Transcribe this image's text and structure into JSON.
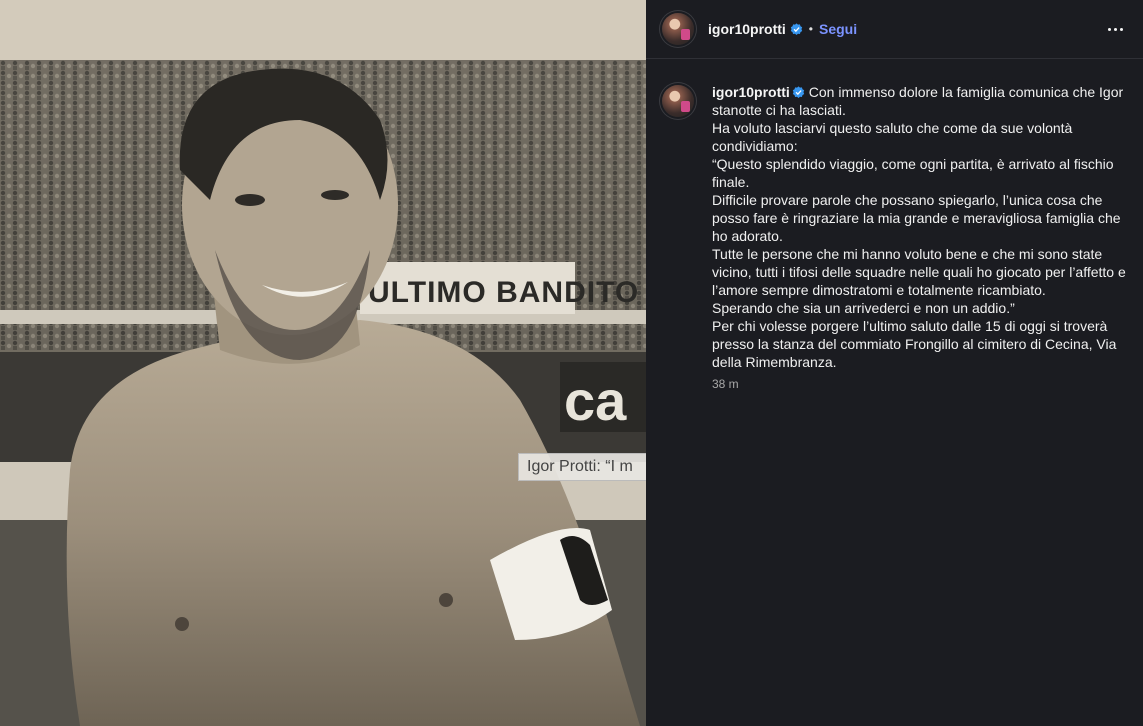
{
  "media": {
    "overlay_label": "Igor Protti: “I m",
    "banner_text": "ULTIMO BANDITO",
    "sponsor_text": "ca"
  },
  "header": {
    "username": "igor10protti",
    "separator": "•",
    "follow_label": "Segui",
    "more_icon": "more-horizontal-icon"
  },
  "caption": {
    "username": "igor10protti",
    "text": "Con immenso dolore la famiglia comunica che Igor stanotte ci ha lasciati.\nHa voluto lasciarvi questo saluto che come da sue volontà condividiamo:\n“Questo splendido viaggio, come ogni partita, è arrivato al fischio finale.\nDifficile provare parole che possano spiegarlo, l’unica cosa che posso fare è ringraziare la mia grande e meravigliosa famiglia che ho adorato.\nTutte le persone che mi hanno voluto bene e che mi sono state vicino, tutti i tifosi delle squadre nelle quali ho giocato per l’affetto e l’amore sempre dimostratomi e totalmente ricambiato.\nSperando che sia un arrivederci e non un addio.”\nPer chi volesse porgere l’ultimo saluto dalle 15 di oggi si troverà presso la stanza del commiato Frongillo al cimitero di Cecina, Via della Rimembranza.",
    "time": "38 m"
  },
  "colors": {
    "panel_bg": "#1b1c21",
    "accent_link": "#7b93ff",
    "verified_badge": "#3897f0"
  }
}
